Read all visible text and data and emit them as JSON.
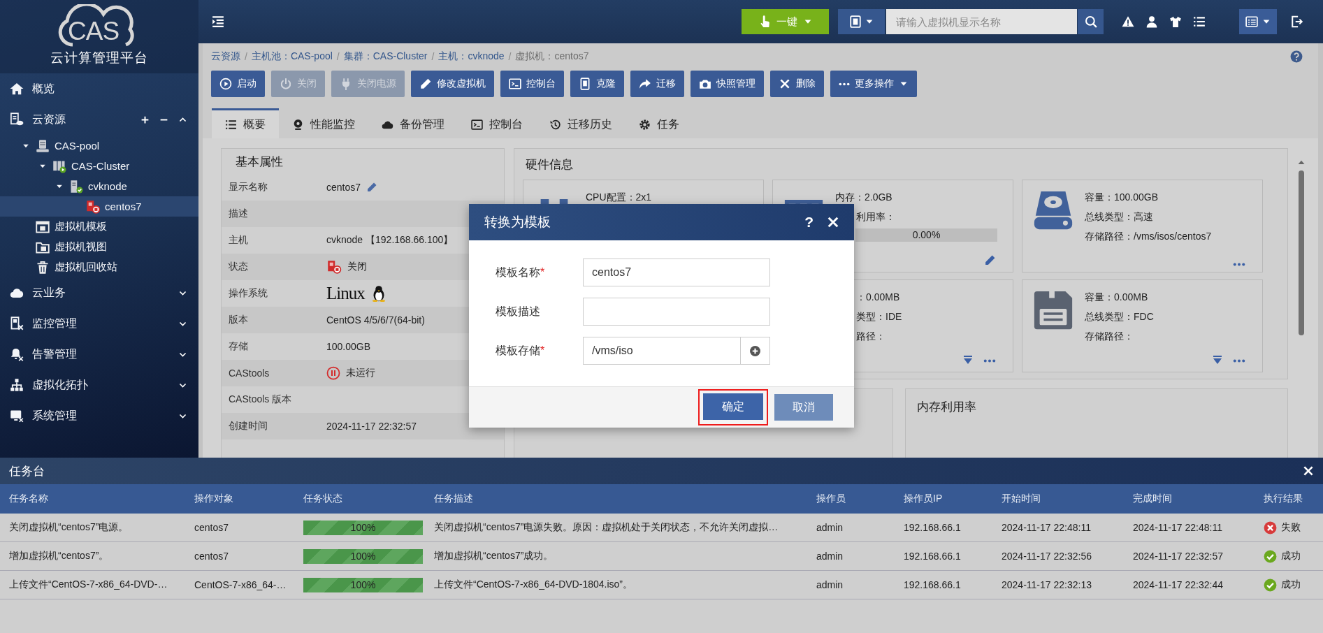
{
  "sidebar": {
    "logo": "CAS",
    "subtitle": "云计算管理平台",
    "nav": [
      {
        "label": "概览",
        "kind": "link"
      },
      {
        "label": "云资源",
        "kind": "section",
        "expanded": true,
        "children": [
          {
            "label": "CAS-pool",
            "kind": "pool",
            "expanded": true,
            "selected": false,
            "children": [
              {
                "label": "CAS-Cluster",
                "kind": "cluster",
                "expanded": true,
                "selected": false,
                "children": [
                  {
                    "label": "cvknode",
                    "kind": "host",
                    "expanded": true,
                    "selected": false,
                    "children": [
                      {
                        "label": "centos7",
                        "kind": "vm",
                        "selected": true
                      }
                    ]
                  }
                ]
              }
            ]
          },
          {
            "label": "虚拟机模板",
            "kind": "template",
            "selected": false
          },
          {
            "label": "虚拟机视图",
            "kind": "view",
            "selected": false
          },
          {
            "label": "虚拟机回收站",
            "kind": "recycle",
            "selected": false
          }
        ]
      },
      {
        "label": "云业务",
        "kind": "section",
        "expanded": false
      },
      {
        "label": "监控管理",
        "kind": "section",
        "expanded": false
      },
      {
        "label": "告警管理",
        "kind": "section",
        "expanded": false
      },
      {
        "label": "虚拟化拓扑",
        "kind": "section",
        "expanded": false
      },
      {
        "label": "系统管理",
        "kind": "section",
        "expanded": false
      }
    ]
  },
  "topbar": {
    "quick_button": "一键",
    "search": {
      "placeholder": "请输入虚拟机显示名称"
    }
  },
  "breadcrumb": {
    "separator": "/",
    "items": [
      "云资源",
      "主机池：CAS-pool",
      "集群：CAS-Cluster",
      "主机：cvknode",
      "虚拟机：centos7"
    ]
  },
  "toolbar": [
    {
      "label": "启动",
      "disabled": false
    },
    {
      "label": "关闭",
      "disabled": true
    },
    {
      "label": "关闭电源",
      "disabled": true
    },
    {
      "label": "修改虚拟机",
      "disabled": false
    },
    {
      "label": "控制台",
      "disabled": false
    },
    {
      "label": "克隆",
      "disabled": false
    },
    {
      "label": "迁移",
      "disabled": false
    },
    {
      "label": "快照管理",
      "disabled": false
    },
    {
      "label": "删除",
      "disabled": false
    },
    {
      "label": "更多操作",
      "disabled": false
    }
  ],
  "tabs": [
    {
      "label": "概要",
      "selected": true
    },
    {
      "label": "性能监控",
      "selected": false
    },
    {
      "label": "备份管理",
      "selected": false
    },
    {
      "label": "控制台",
      "selected": false
    },
    {
      "label": "迁移历史",
      "selected": false
    },
    {
      "label": "任务",
      "selected": false
    }
  ],
  "basic_properties": {
    "title": "基本属性",
    "rows": [
      {
        "label": "显示名称",
        "value": "centos7",
        "kind": "editable"
      },
      {
        "label": "描述",
        "kind": "text"
      },
      {
        "label": "主机",
        "value": "cvknode 【192.168.66.100】",
        "kind": "text"
      },
      {
        "label": "状态",
        "value": "关闭",
        "kind": "vm_state"
      },
      {
        "label": "操作系统",
        "value": "Linux",
        "kind": "os"
      },
      {
        "label": "版本",
        "value": "CentOS 4/5/6/7(64-bit)",
        "kind": "text"
      },
      {
        "label": "存储",
        "value": "100.00GB",
        "kind": "text"
      },
      {
        "label": "CAStools",
        "value": "未运行",
        "kind": "tools_state"
      },
      {
        "label": "CAStools 版本",
        "kind": "text"
      },
      {
        "label": "创建时间",
        "value": "2024-11-17 22:32:57",
        "kind": "text"
      }
    ]
  },
  "hardware": {
    "title": "硬件信息",
    "cards": [
      {
        "kind": "cpu",
        "lines": [
          "CPU配置：2x1"
        ]
      },
      {
        "kind": "memory",
        "lines": [
          "内存：2.0GB",
          "利用率："
        ],
        "level": 0,
        "reading": "0.00%"
      },
      {
        "kind": "disk",
        "lines": [
          "容量：100.00GB",
          "总线类型：高速",
          "存储路径：/vms/isos/centos7"
        ]
      },
      {
        "kind": "cdrom",
        "lines": [
          "：0.00MB",
          "类型：IDE",
          "路径："
        ]
      },
      {
        "kind": "floppy",
        "lines": [
          "容量：0.00MB",
          "总线类型：FDC",
          "存储路径："
        ]
      }
    ]
  },
  "usage_panels": [
    {
      "title": "内存利用率"
    }
  ],
  "dialog": {
    "title": "转换为模板",
    "help": "?",
    "required_mark": "*",
    "fields": [
      {
        "label": "模板名称",
        "required": true,
        "value": "centos7",
        "kind": "text"
      },
      {
        "label": "模板描述",
        "required": false,
        "kind": "text"
      },
      {
        "label": "模板存储",
        "required": true,
        "value": "/vms/iso",
        "kind": "picker"
      }
    ],
    "buttons": [
      {
        "label": "确定",
        "kind": "primary",
        "highlighted": true
      },
      {
        "label": "取消",
        "kind": "secondary"
      }
    ]
  },
  "tasks": {
    "title": "任务台",
    "columns": [
      "任务名称",
      "操作对象",
      "任务状态",
      "任务描述",
      "操作员",
      "操作员IP",
      "开始时间",
      "完成时间",
      "执行结果"
    ],
    "rows": [
      {
        "name": "关闭虚拟机“centos7”电源。",
        "target": "centos7",
        "status": {
          "level": 1,
          "reading": "100%"
        },
        "description": "关闭虚拟机“centos7”电源失败。原因：虚拟机处于关闭状态，不允许关闭虚拟…",
        "operator": "admin",
        "operator_ip": "192.168.66.1",
        "start": "2024-11-17 22:48:11",
        "end": "2024-11-17 22:48:11",
        "result": {
          "kind": "fail",
          "label": "失败"
        }
      },
      {
        "name": "增加虚拟机“centos7”。",
        "target": "centos7",
        "status": {
          "level": 1,
          "reading": "100%"
        },
        "description": "增加虚拟机“centos7”成功。",
        "operator": "admin",
        "operator_ip": "192.168.66.1",
        "start": "2024-11-17 22:32:56",
        "end": "2024-11-17 22:32:57",
        "result": {
          "kind": "success",
          "label": "成功"
        }
      },
      {
        "name": "上传文件“CentOS-7-x86_64-DVD-…",
        "target": "CentOS-7-x86_64-…",
        "status": {
          "level": 1,
          "reading": "100%"
        },
        "description": "上传文件“CentOS-7-x86_64-DVD-1804.iso”。",
        "operator": "admin",
        "operator_ip": "192.168.66.1",
        "start": "2024-11-17 22:32:13",
        "end": "2024-11-17 22:32:44",
        "result": {
          "kind": "success",
          "label": "成功"
        }
      }
    ]
  }
}
